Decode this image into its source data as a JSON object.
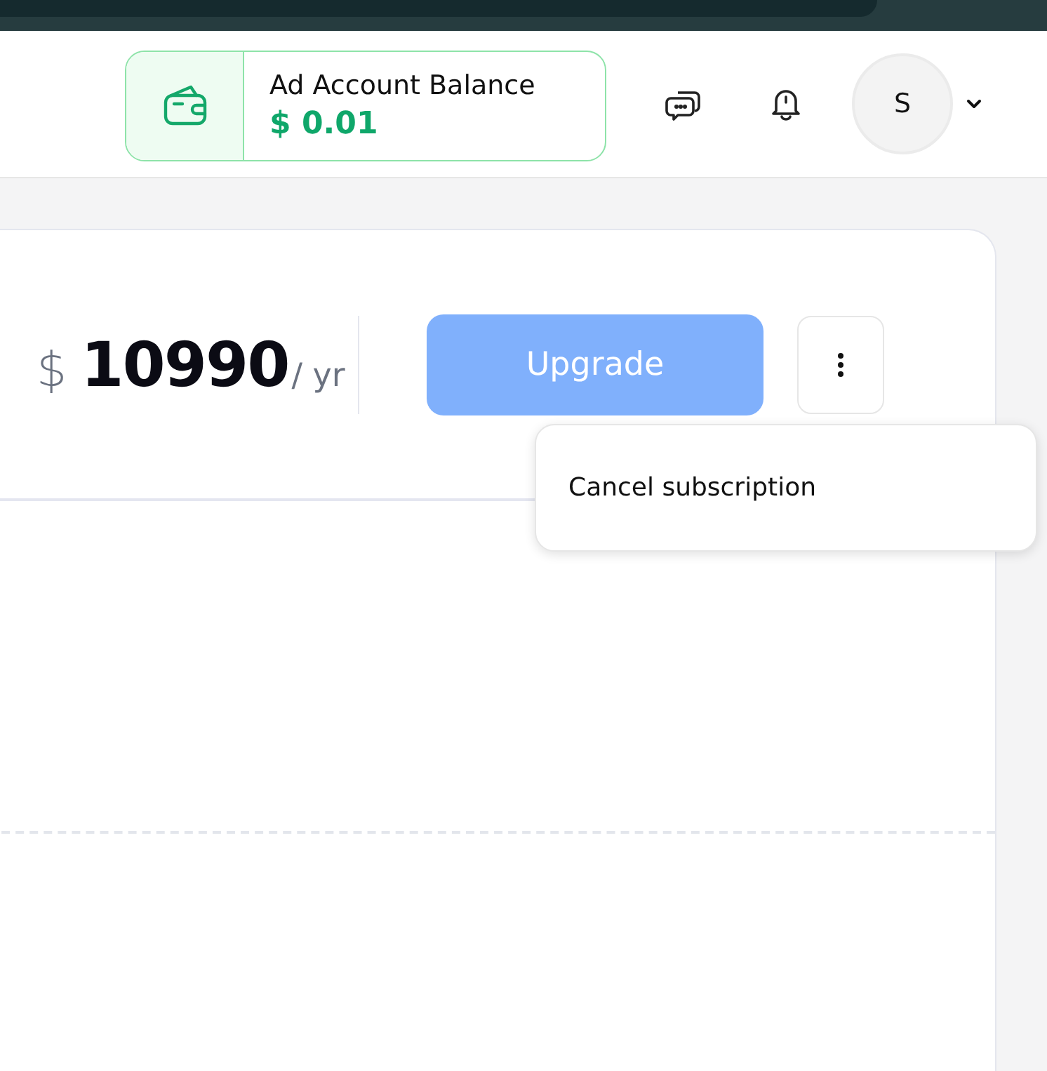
{
  "header": {
    "balance": {
      "label": "Ad Account Balance",
      "amount": "$ 0.01"
    },
    "avatar": {
      "initial": "S"
    }
  },
  "plan": {
    "currency": "$",
    "price": "10990",
    "period": "/ yr",
    "upgrade_button": "Upgrade"
  },
  "menu": {
    "open": true,
    "items": [
      "Cancel subscription"
    ]
  }
}
